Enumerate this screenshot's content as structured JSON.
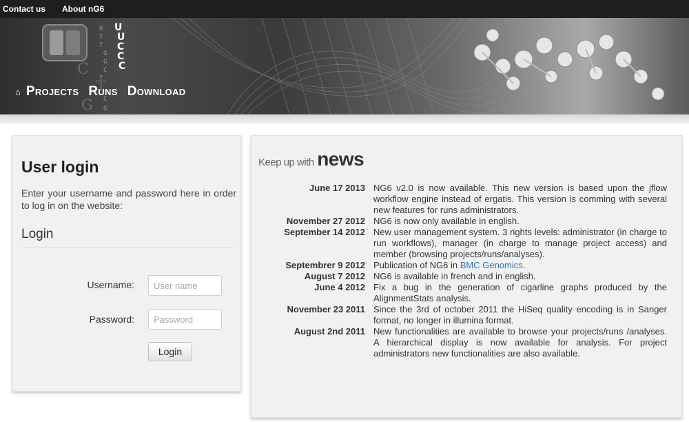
{
  "top_nav": {
    "contact": "Contact us",
    "about": "About nG6"
  },
  "banner": {
    "home_icon": "home-icon",
    "nav": [
      "Projects",
      "Runs",
      "Download"
    ],
    "logo_letters": [
      "C",
      "T",
      "G"
    ]
  },
  "login": {
    "title": "User login",
    "description": "Enter your username and password here in order to log in on the website:",
    "subtitle": "Login",
    "username_label": "Username:",
    "username_placeholder": "User name",
    "password_label": "Password:",
    "password_placeholder": "Password",
    "button": "Login"
  },
  "news": {
    "heading_small": "Keep up with",
    "heading_big": "news",
    "items": [
      {
        "date": "June 17 2013",
        "text": "NG6 v2.0 is now available. This new version is based upon the jflow workflow engine instead of ergatis. This version is comming with several new features for runs administrators."
      },
      {
        "date": "November 27 2012",
        "text": "NG6 is now only available in english."
      },
      {
        "date": "September 14 2012",
        "text": "New user management system. 3 rights levels: administrator (in charge to run workflows), manager (in charge to manage project access) and member (browsing projects/runs/analyses)."
      },
      {
        "date": "Septembrer 9 2012",
        "text_before": "Publication of NG6 in ",
        "link": "BMC Genomics",
        "text_after": "."
      },
      {
        "date": "August 7 2012",
        "text": "NG6 is available in french and in english."
      },
      {
        "date": "June 4 2012",
        "text": "Fix a bug in the generation of cigarline graphs produced by the AlignmentStats analysis."
      },
      {
        "date": "November 23 2011",
        "text": "Since the 3rd of october 2011 the HiSeq quality encoding is in Sanger format, no longer in illumina format."
      },
      {
        "date": "August 2nd 2011",
        "text": "New functionalities are available to browse your projects/runs /analyses. A hierarchical display is now available for analysis. For project administrators new functionalities are also available."
      }
    ]
  },
  "colors": {
    "topbar": "#1e1e1e",
    "link": "#2a72b8"
  }
}
